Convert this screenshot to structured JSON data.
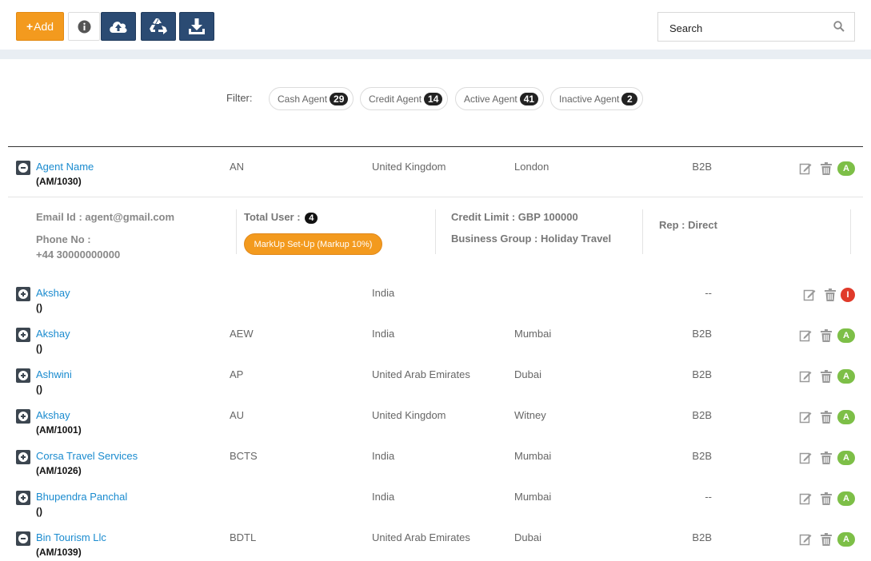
{
  "toolbar": {
    "add_label": "Add",
    "search_placeholder": "Search"
  },
  "filters": {
    "label": "Filter:",
    "chips": [
      {
        "label": "Cash Agent",
        "count": "29"
      },
      {
        "label": "Credit Agent",
        "count": "14"
      },
      {
        "label": "Active Agent",
        "count": "41"
      },
      {
        "label": "Inactive Agent",
        "count": "2"
      }
    ]
  },
  "rows": [
    {
      "name": "Agent Name",
      "code": "(AM/1030)",
      "short": "AN",
      "country": "United Kingdom",
      "city": "London",
      "type": "B2B",
      "status": "A",
      "expanded": true
    },
    {
      "name": "Akshay",
      "code": "()",
      "short": "",
      "country": "India",
      "city": "",
      "type": "--",
      "status": "I",
      "expanded": false
    },
    {
      "name": "Akshay",
      "code": "()",
      "short": "AEW",
      "country": "India",
      "city": "Mumbai",
      "type": "B2B",
      "status": "A",
      "expanded": false
    },
    {
      "name": "Ashwini",
      "code": "()",
      "short": "AP",
      "country": "United Arab Emirates",
      "city": "Dubai",
      "type": "B2B",
      "status": "A",
      "expanded": false
    },
    {
      "name": "Akshay",
      "code": "(AM/1001)",
      "short": "AU",
      "country": "United Kingdom",
      "city": "Witney",
      "type": "B2B",
      "status": "A",
      "expanded": false
    },
    {
      "name": "Corsa Travel Services",
      "code": "(AM/1026)",
      "short": "BCTS",
      "country": "India",
      "city": "Mumbai",
      "type": "B2B",
      "status": "A",
      "expanded": false
    },
    {
      "name": "Bhupendra Panchal",
      "code": "()",
      "short": "",
      "country": "India",
      "city": "Mumbai",
      "type": "--",
      "status": "A",
      "expanded": false
    },
    {
      "name": "Bin Tourism Llc",
      "code": "(AM/1039)",
      "short": "BDTL",
      "country": "United Arab Emirates",
      "city": "Dubai",
      "type": "B2B",
      "status": "A",
      "expanded": true
    }
  ],
  "detail": {
    "email": "Email Id : agent@gmail.com",
    "phone_label": "Phone No :",
    "phone": "+44 30000000000",
    "total_user_label": "Total User :",
    "total_user_count": "4",
    "markup_label": "MarkUp Set-Up (Markup 10%)",
    "credit_limit": "Credit Limit : GBP 100000",
    "business_group_label": "Business Group :",
    "business_group": "Holiday Travel",
    "rep": "Rep : Direct"
  },
  "colors": {
    "accent_orange": "#f39a1e",
    "dark_blue": "#2b4b73",
    "link_blue": "#1a8bcf",
    "active_green": "#7dbf47",
    "inactive_red": "#e03a2a"
  }
}
